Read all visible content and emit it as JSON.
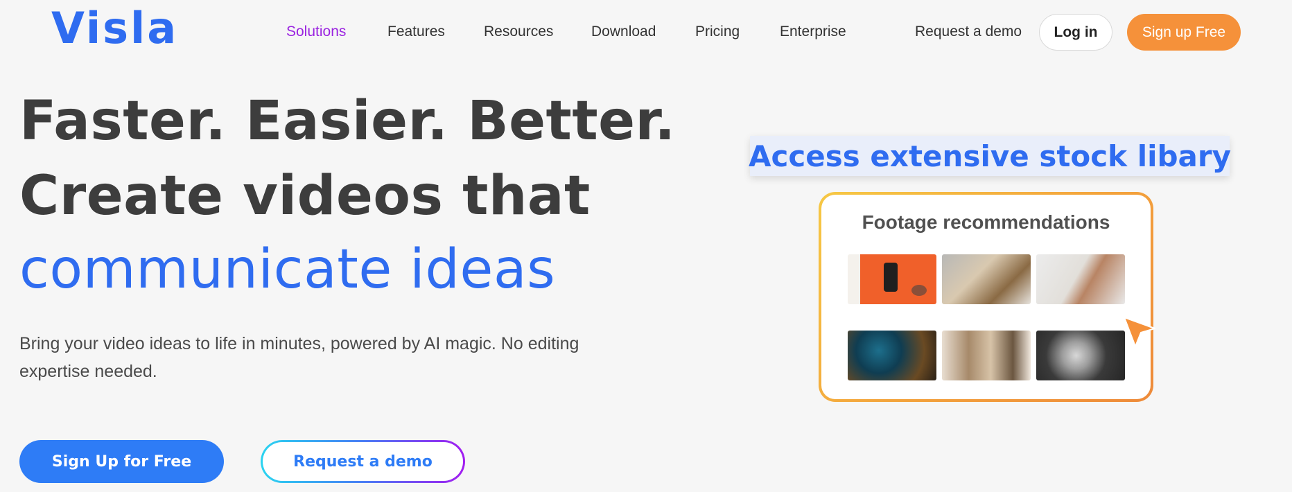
{
  "brand": {
    "logo_text": "Visla",
    "color": "#2f6cf0"
  },
  "nav": {
    "items": [
      {
        "label": "Solutions",
        "active": true
      },
      {
        "label": "Features",
        "active": false
      },
      {
        "label": "Resources",
        "active": false
      },
      {
        "label": "Download",
        "active": false
      },
      {
        "label": "Pricing",
        "active": false
      },
      {
        "label": "Enterprise",
        "active": false
      }
    ],
    "active_color": "#9a23e0"
  },
  "header_actions": {
    "demo_label": "Request a demo",
    "login_label": "Log in",
    "signup_label": "Sign up Free",
    "signup_color": "#f5913a"
  },
  "hero": {
    "line1": "Faster. Easier. Better.",
    "line2": "Create videos that",
    "line3": "communicate ideas",
    "subtitle": "Bring your video ideas to life in minutes, powered by AI magic. No editing expertise needed.",
    "primary_cta": "Sign Up for Free",
    "secondary_cta": "Request a demo",
    "primary_color": "#2e7cf6"
  },
  "illustration": {
    "banner_text": "Access extensive stock libary",
    "card_title": "Footage recommendations",
    "thumbnails": [
      "orange-desk-phone",
      "office-team-meeting",
      "hand-on-keyboard",
      "aerial-city-night",
      "workshop-crowd",
      "marble-statue"
    ],
    "cursor_icon": "pointer-arrow-icon",
    "cursor_color": "#f5913a"
  }
}
